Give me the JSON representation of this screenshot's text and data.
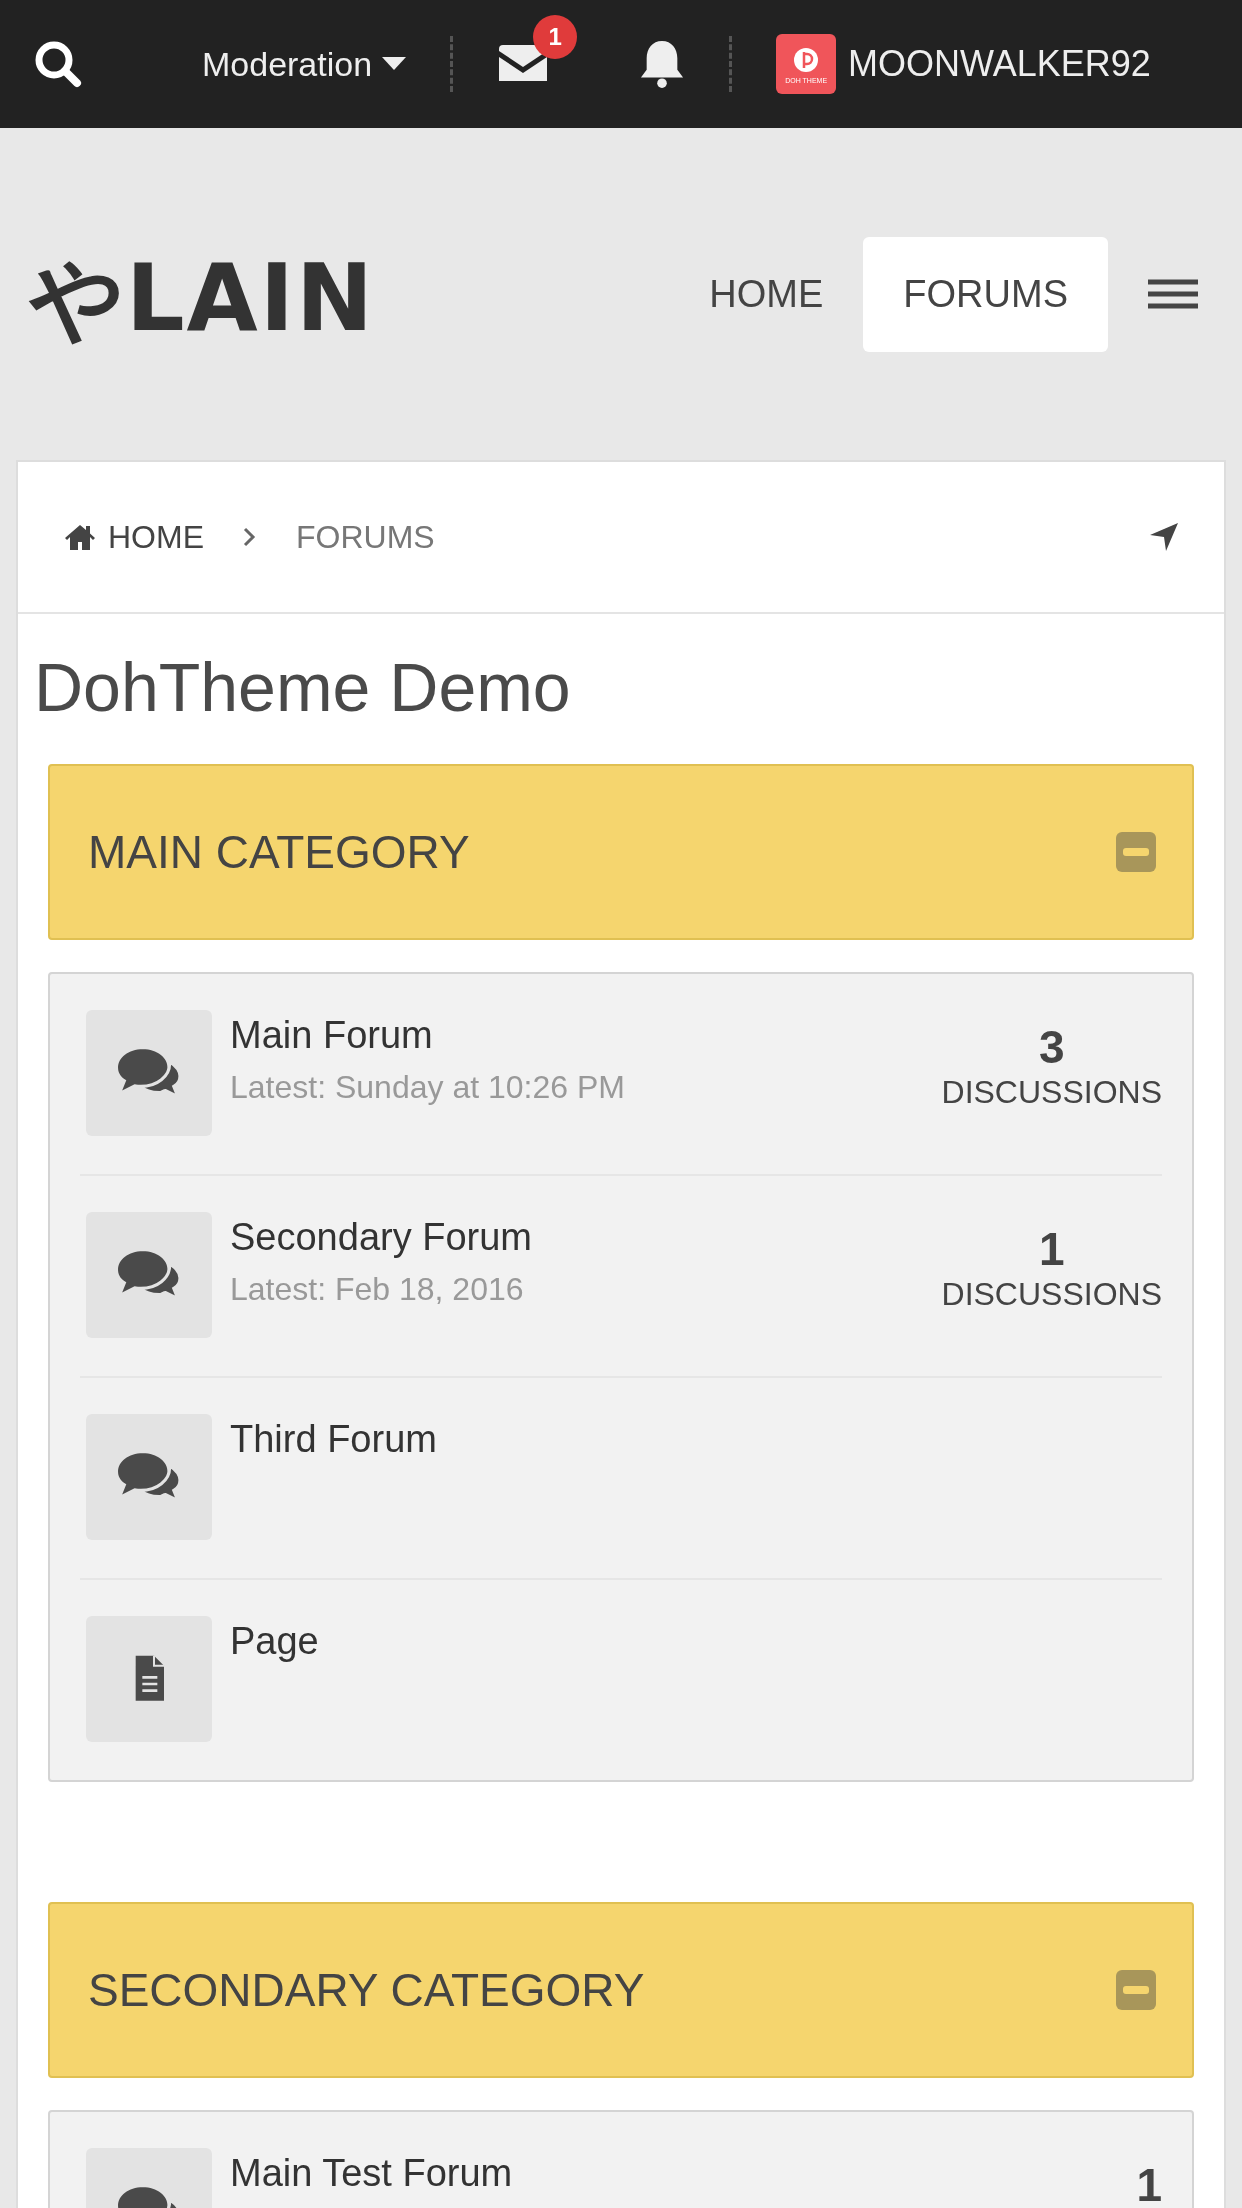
{
  "top_bar": {
    "moderation": "Moderation",
    "messages_badge": "1",
    "avatar_caption": "DOH THEME",
    "username": "MOONWALKER92"
  },
  "header": {
    "logo": "やLAIN",
    "nav": [
      {
        "label": "HOME",
        "selected": false
      },
      {
        "label": "FORUMS",
        "selected": true
      }
    ]
  },
  "breadcrumb": [
    "HOME",
    "FORUMS"
  ],
  "page_title": "DohTheme Demo",
  "categories": [
    {
      "title": "MAIN CATEGORY",
      "expanded": true,
      "nodes": [
        {
          "kind": "forum",
          "name": "Main Forum",
          "latest": "Latest: Sunday at 10:26 PM",
          "count": "3",
          "count_label": "DISCUSSIONS"
        },
        {
          "kind": "forum",
          "name": "Secondary Forum",
          "latest": "Latest: Feb 18, 2016",
          "count": "1",
          "count_label": "DISCUSSIONS"
        },
        {
          "kind": "forum",
          "name": "Third Forum"
        },
        {
          "kind": "page",
          "name": "Page"
        }
      ]
    },
    {
      "title": "SECONDARY CATEGORY",
      "expanded": true,
      "nodes": [
        {
          "kind": "forum",
          "name": "Main Test Forum",
          "count": "1"
        }
      ]
    }
  ]
}
